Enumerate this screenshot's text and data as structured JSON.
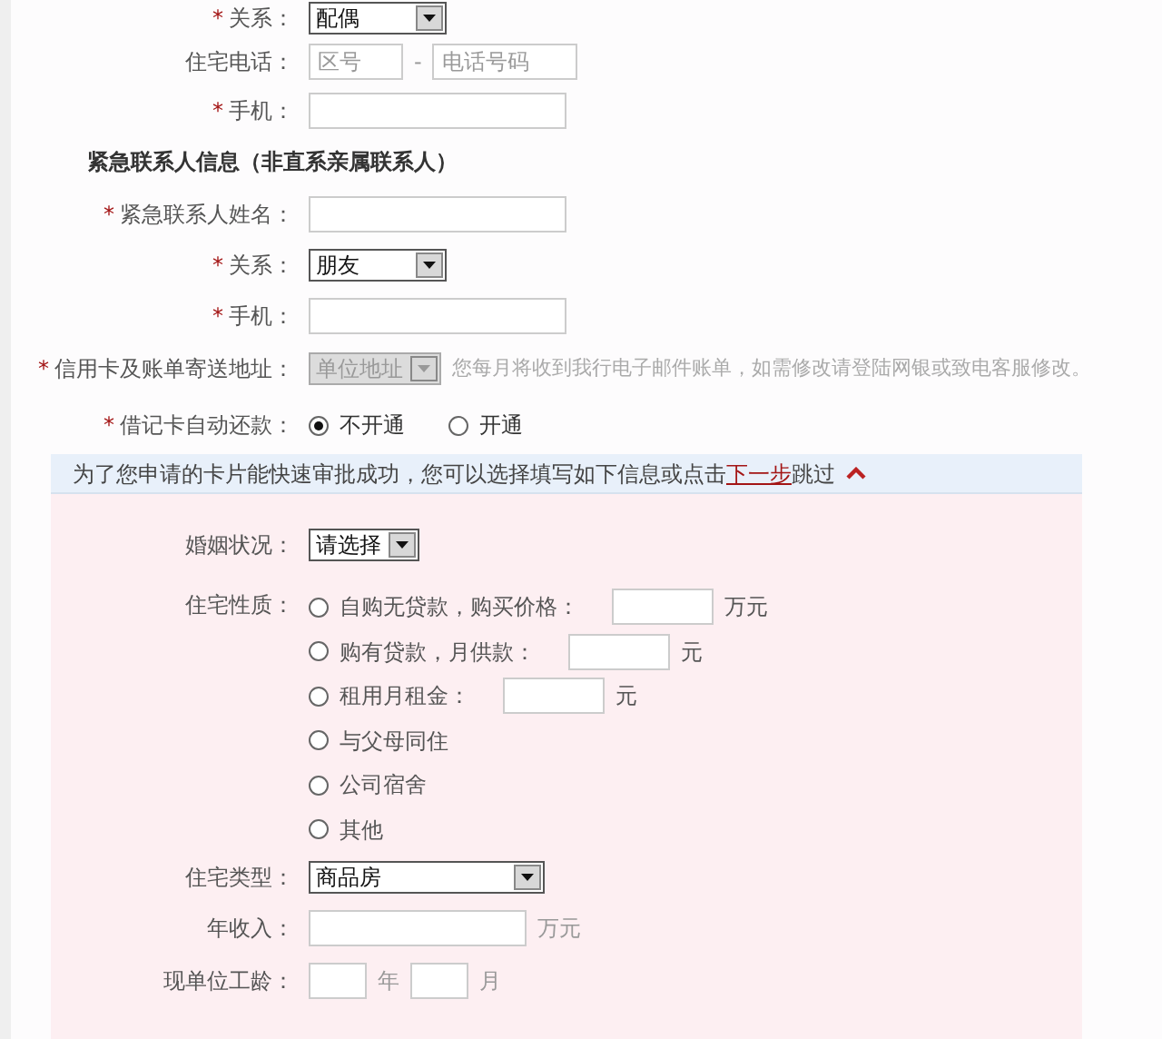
{
  "contact_fields": [
    {
      "kind": "select",
      "marker": "*",
      "label": "关系：",
      "value": "配偶"
    },
    {
      "kind": "phone",
      "label": "住宅电话：",
      "area_placeholder": "区号",
      "separator": "-",
      "number_placeholder": "电话号码"
    },
    {
      "kind": "text",
      "marker": "*",
      "label": "手机："
    }
  ],
  "emergency": {
    "heading": "紧急联系人信息（非直系亲属联系人）",
    "fields": [
      {
        "kind": "text",
        "marker": "*",
        "label": "紧急联系人姓名："
      },
      {
        "kind": "select",
        "marker": "*",
        "label": "关系：",
        "value": "朋友"
      },
      {
        "kind": "text",
        "marker": "*",
        "label": "手机："
      }
    ]
  },
  "billing": {
    "marker": "*",
    "label": "信用卡及账单寄送地址：",
    "value": "单位地址",
    "disabled": true,
    "note": "您每月将收到我行电子邮件账单，如需修改请登陆网银或致电客服修改。"
  },
  "autopay": {
    "marker": "*",
    "label": "借记卡自动还款：",
    "options": [
      {
        "label": "不开通",
        "selected": true
      },
      {
        "label": "开通",
        "selected": false
      }
    ]
  },
  "optional": {
    "banner": {
      "text_before": "为了您申请的卡片能快速审批成功，您可以选择填写如下信息或点击",
      "link": "下一步",
      "text_after": "跳过",
      "expanded": true
    },
    "marital": {
      "label": "婚姻状况：",
      "value": "请选择"
    },
    "housing": {
      "label": "住宅性质：",
      "options": [
        {
          "kind": "amount",
          "label": "自购无贷款，购买价格：",
          "unit": "万元",
          "selected": false
        },
        {
          "kind": "amount",
          "label": "购有贷款，月供款：",
          "unit": "元",
          "selected": false
        },
        {
          "kind": "amount",
          "label": "租用月租金：",
          "unit": "元",
          "selected": false
        },
        {
          "kind": "plain",
          "label": "与父母同住",
          "selected": false
        },
        {
          "kind": "plain",
          "label": "公司宿舍",
          "selected": false
        },
        {
          "kind": "plain",
          "label": "其他",
          "selected": false
        }
      ]
    },
    "housing_type": {
      "label": "住宅类型：",
      "value": "商品房"
    },
    "income": {
      "label": "年收入：",
      "unit": "万元"
    },
    "tenure": {
      "label": "现单位工龄：",
      "year_unit": "年",
      "month_unit": "月"
    }
  }
}
